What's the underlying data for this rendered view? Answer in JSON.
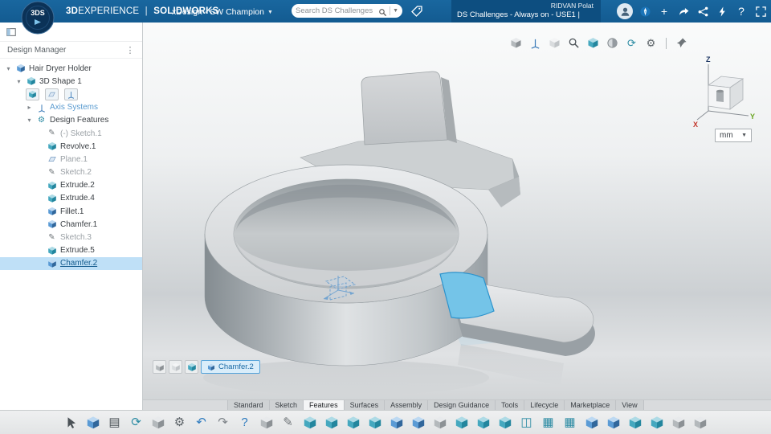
{
  "topbar": {
    "logo_text": "3DS",
    "brand_bold": "3D",
    "brand_rest": "EXPERIENCE",
    "brand_divider": "|",
    "brand_product": "SOLIDWORKS",
    "app_title": "xDesign - SW Champion",
    "search_placeholder": "Search DS Challenges",
    "user_name": "RIDVAN Polat",
    "workspace_label": "DS Challenges - Always on - USE1 |",
    "right_icons": [
      {
        "name": "avatar",
        "glyph": "person"
      },
      {
        "name": "compass-icon",
        "glyph": "compass"
      },
      {
        "name": "add-content-icon",
        "glyph": "plus"
      },
      {
        "name": "share-icon",
        "glyph": "share"
      },
      {
        "name": "community-icon",
        "glyph": "nodes"
      },
      {
        "name": "assistant-icon",
        "glyph": "bolt"
      },
      {
        "name": "help-icon",
        "glyph": "help"
      },
      {
        "name": "apps-grid-icon",
        "glyph": "grid"
      }
    ]
  },
  "left_panel": {
    "title": "Design Manager",
    "tree": [
      {
        "label": "Hair Dryer Holder",
        "level": 0,
        "icon": "cubeB",
        "expander": "open"
      },
      {
        "label": "3D Shape 1",
        "level": 1,
        "icon": "cubeT",
        "expander": "open"
      },
      {
        "type": "icon-row",
        "level": 2,
        "icons": [
          {
            "name": "bodies-filter-icon",
            "glyph": "cubeT"
          },
          {
            "name": "sketches-filter-icon",
            "glyph": "plane"
          },
          {
            "name": "references-filter-icon",
            "glyph": "axes"
          }
        ]
      },
      {
        "label": "Axis Systems",
        "level": 2,
        "icon": "axes",
        "expander": "closed",
        "blue": true
      },
      {
        "label": "Design Features",
        "level": 2,
        "icon": "gearT",
        "expander": "open"
      },
      {
        "label": "(-) Sketch.1",
        "level": 3,
        "icon": "pencil",
        "muted": true
      },
      {
        "label": "Revolve.1",
        "level": 3,
        "icon": "cubeT"
      },
      {
        "label": "Plane.1",
        "level": 3,
        "icon": "plane",
        "muted": true
      },
      {
        "label": "Sketch.2",
        "level": 3,
        "icon": "pencil",
        "muted": true
      },
      {
        "label": "Extrude.2",
        "level": 3,
        "icon": "cubeT"
      },
      {
        "label": "Extrude.4",
        "level": 3,
        "icon": "cubeT"
      },
      {
        "label": "Fillet.1",
        "level": 3,
        "icon": "cubeB"
      },
      {
        "label": "Chamfer.1",
        "level": 3,
        "icon": "cubeB"
      },
      {
        "label": "Sketch.3",
        "level": 3,
        "icon": "pencil",
        "muted": true
      },
      {
        "label": "Extrude.5",
        "level": 3,
        "icon": "cubeT"
      },
      {
        "label": "Chamfer.2",
        "level": 3,
        "icon": "cubeB",
        "selected": true
      }
    ]
  },
  "viewport": {
    "toolbar": [
      {
        "name": "shaded-view-icon",
        "glyph": "cubeG"
      },
      {
        "name": "normal-to-icon",
        "glyph": "axes"
      },
      {
        "name": "hidden-line-icon",
        "glyph": "cubeL"
      },
      {
        "name": "zoom-fit-icon",
        "glyph": "zoom"
      },
      {
        "name": "isometric-view-icon",
        "glyph": "cubeT"
      },
      {
        "name": "section-view-icon",
        "glyph": "section"
      },
      {
        "name": "refresh-view-icon",
        "glyph": "refresh"
      },
      {
        "name": "display-settings-icon",
        "glyph": "gear"
      },
      {
        "type": "divider"
      },
      {
        "name": "pin-icon",
        "glyph": "pin"
      }
    ],
    "triad": {
      "x": "X",
      "y": "Y",
      "z": "Z"
    },
    "units_value": "mm",
    "context_toolbar": {
      "icons": [
        {
          "name": "hide-show-icon",
          "glyph": "cubeG"
        },
        {
          "name": "display-mode-icon",
          "glyph": "cubeL"
        },
        {
          "name": "feature-options-icon",
          "glyph": "cubeT"
        }
      ],
      "chip_label": "Chamfer.2"
    }
  },
  "bottom": {
    "tabs": [
      {
        "label": "Standard"
      },
      {
        "label": "Sketch"
      },
      {
        "label": "Features",
        "active": true
      },
      {
        "label": "Surfaces"
      },
      {
        "label": "Assembly"
      },
      {
        "label": "Design Guidance"
      },
      {
        "label": "Tools"
      },
      {
        "label": "Lifecycle"
      },
      {
        "label": "Marketplace"
      },
      {
        "label": "View"
      }
    ],
    "toolbar": [
      {
        "name": "select-icon",
        "glyph": "cursor"
      },
      {
        "name": "design-assistant-icon",
        "glyph": "cubeB"
      },
      {
        "name": "save-icon",
        "glyph": "save"
      },
      {
        "name": "update-icon",
        "glyph": "refresh"
      },
      {
        "name": "insert-icon",
        "glyph": "cubeG"
      },
      {
        "name": "settings-icon",
        "glyph": "gear"
      },
      {
        "name": "undo-icon",
        "glyph": "undo"
      },
      {
        "name": "redo-icon",
        "glyph": "redo"
      },
      {
        "name": "help-icon",
        "glyph": "help"
      },
      {
        "name": "primitive-icon",
        "glyph": "cubeG"
      },
      {
        "name": "sketch-icon",
        "glyph": "pencil"
      },
      {
        "name": "extrude-icon",
        "glyph": "cubeT"
      },
      {
        "name": "revolve-icon",
        "glyph": "cubeT"
      },
      {
        "name": "sweep-icon",
        "glyph": "cubeT"
      },
      {
        "name": "loft-icon",
        "glyph": "cubeT"
      },
      {
        "name": "fill-icon",
        "glyph": "cubeB"
      },
      {
        "name": "pocket-icon",
        "glyph": "cubeB"
      },
      {
        "name": "hole-icon",
        "glyph": "cubeG"
      },
      {
        "name": "shell-icon",
        "glyph": "cubeT"
      },
      {
        "name": "rib-icon",
        "glyph": "cubeT"
      },
      {
        "name": "draft-icon",
        "glyph": "cubeT"
      },
      {
        "name": "mirror-icon",
        "glyph": "mirror"
      },
      {
        "name": "linear-pattern-icon",
        "glyph": "pattern"
      },
      {
        "name": "circular-pattern-icon",
        "glyph": "pattern"
      },
      {
        "name": "fillet-icon",
        "glyph": "cubeB"
      },
      {
        "name": "chamfer-icon",
        "glyph": "cubeB"
      },
      {
        "name": "combine-icon",
        "glyph": "cubeT"
      },
      {
        "name": "split-icon",
        "glyph": "cubeT"
      },
      {
        "name": "scale-icon",
        "glyph": "cubeG"
      },
      {
        "name": "measure-icon",
        "glyph": "cubeG"
      }
    ]
  }
}
